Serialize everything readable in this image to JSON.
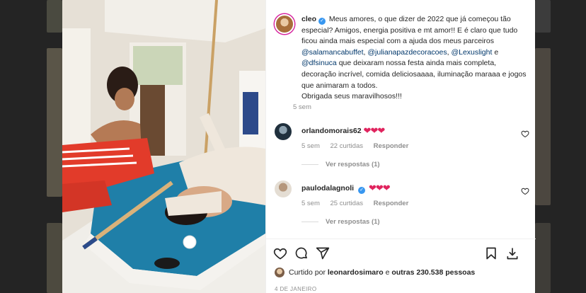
{
  "post": {
    "author": "cleo",
    "caption_before": " Meus amores, o que dizer de 2022 que já começou tão especial? Amigos, energia positiva e mt amor!! E é claro que tudo ficou ainda mais especial com a ajuda dos meus parceiros ",
    "mention_1": "@salamancabuffet",
    "sep_1": ", ",
    "mention_2": "@julianapazdecoracoes",
    "sep_2": ", ",
    "mention_3": "@Lexuslight",
    "sep_3": " e ",
    "mention_4": "@dfsinuca",
    "caption_after": " que deixaram nossa festa ainda mais completa, decoração incrível, comida deliciosaaaa, iluminação maraaa e jogos que animaram a todos.",
    "caption_end": "Obrigada seus maravilhosos!!!",
    "time": "5 sem"
  },
  "comments": [
    {
      "username": "orlandomorais62",
      "text": "❤❤❤",
      "time": "5 sem",
      "likes": "22 curtidas",
      "reply_label": "Responder",
      "view_replies": "Ver respostas (1)"
    },
    {
      "username": "paulodalagnoli",
      "text": "❤❤❤",
      "time": "5 sem",
      "likes": "25 curtidas",
      "reply_label": "Responder",
      "view_replies": "Ver respostas (1)"
    }
  ],
  "likes": {
    "prefix": "Curtido por ",
    "user": "leonardosimaro",
    "middle": " e ",
    "others": "outras 230.538 pessoas"
  },
  "date": "4 DE JANEIRO",
  "icons": [
    "heart-icon",
    "comment-icon",
    "share-icon",
    "bookmark-icon",
    "download-icon",
    "verified-icon"
  ],
  "colors": {
    "verified": "#3897f0",
    "heart": "#e0245e",
    "mention": "#00376b",
    "meta": "#8e8e8e"
  }
}
